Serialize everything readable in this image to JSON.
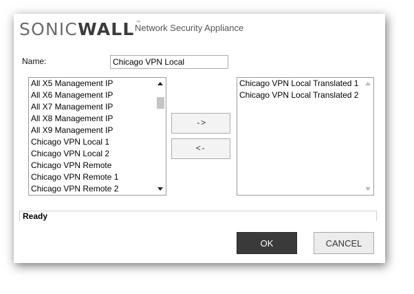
{
  "header": {
    "brand_part1": "SONIC",
    "brand_part2": "WALL",
    "trademark": "™",
    "product": "Network Security Appliance"
  },
  "form": {
    "name_label": "Name:",
    "name_value": "Chicago VPN Local"
  },
  "left_list": {
    "items": [
      "All X5 Management IP",
      "All X6 Management IP",
      "All X7 Management IP",
      "All X8 Management IP",
      "All X9 Management IP",
      "Chicago VPN Local 1",
      "Chicago VPN Local 2",
      "Chicago VPN Remote",
      "Chicago VPN Remote 1",
      "Chicago VPN Remote 2"
    ]
  },
  "right_list": {
    "items": [
      "Chicago VPN Local Translated 1",
      "Chicago VPN Local Translated 2"
    ]
  },
  "buttons": {
    "move_right": "->",
    "move_left": "<-",
    "ok": "OK",
    "cancel": "CANCEL"
  },
  "status": "Ready",
  "colors": {
    "ok_background": "#3a3a3a",
    "cancel_background": "#ececec",
    "brand_gray": "#6b6b6b"
  }
}
